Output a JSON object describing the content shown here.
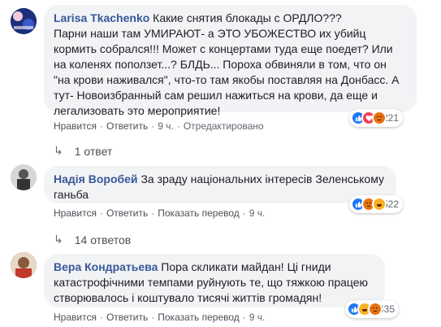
{
  "colors": {
    "author": "#385898",
    "bubble": "#f2f3f5",
    "meta": "#606770"
  },
  "comments": [
    {
      "author": "Larisa Tkachenko",
      "lines": [
        "Какие снятия блокады с ОРДЛО???",
        "Парни наши там УМИРАЮТ- а ЭТО УБОЖЕСТВО их убийц",
        "кормить собрался!!! Может с концертами туда еще поедет? Или",
        "на коленях поползет...? БЛДЬ... Пороха обвиняли в том, что он",
        "\"на крови наживался\", что-то там якобы поставляя на Донбасс. А",
        "тут- Новоизбранный сам решил нажиться на крови, да еще и",
        "легализовать это мероприятие!"
      ],
      "like": "Нравится",
      "reply": "Ответить",
      "time": "9 ч.",
      "edited": "Отредактировано",
      "reaction_count": "221",
      "reactions": [
        "like-icon",
        "love-icon",
        "angry-icon"
      ],
      "replies": "1 ответ"
    },
    {
      "author": "Надія Воробей",
      "lines": [
        "За зраду національних інтересів Зеленському",
        "ганьба"
      ],
      "like": "Нравится",
      "reply": "Ответить",
      "translate": "Показать перевод",
      "time": "9 ч.",
      "reaction_count": "522",
      "reactions": [
        "like-icon",
        "angry-icon",
        "haha-icon"
      ],
      "replies": "14 ответов"
    },
    {
      "author": "Вера Кондратьева",
      "lines": [
        "Пора скликати майдан! Ці гниди",
        "катастрофічними темпами руйнують те, що тяжкою працею",
        "створювалось і коштувало тисячі життів громадян!"
      ],
      "like": "Нравится",
      "reply": "Ответить",
      "translate": "Показать перевод",
      "time": "9 ч.",
      "reaction_count": "435",
      "reactions": [
        "like-icon",
        "haha-icon",
        "angry-icon"
      ]
    }
  ]
}
